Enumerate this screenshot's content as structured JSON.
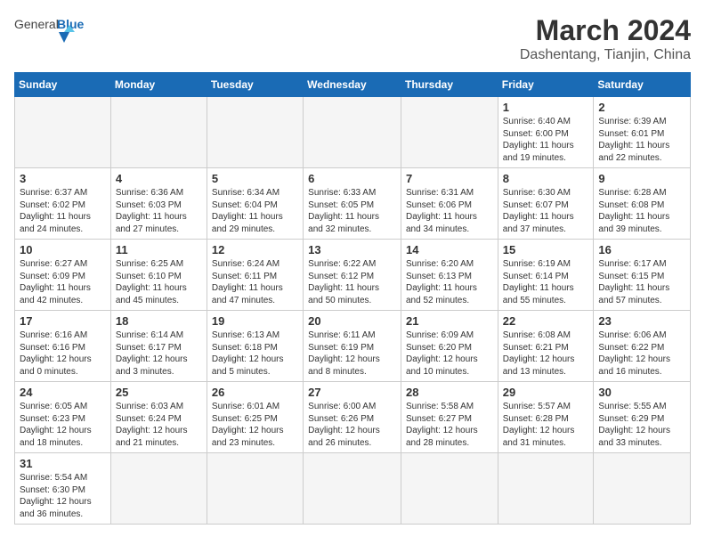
{
  "header": {
    "logo_general": "General",
    "logo_blue": "Blue",
    "month_title": "March 2024",
    "location": "Dashentang, Tianjin, China"
  },
  "weekdays": [
    "Sunday",
    "Monday",
    "Tuesday",
    "Wednesday",
    "Thursday",
    "Friday",
    "Saturday"
  ],
  "weeks": [
    [
      {
        "day": "",
        "info": ""
      },
      {
        "day": "",
        "info": ""
      },
      {
        "day": "",
        "info": ""
      },
      {
        "day": "",
        "info": ""
      },
      {
        "day": "",
        "info": ""
      },
      {
        "day": "1",
        "info": "Sunrise: 6:40 AM\nSunset: 6:00 PM\nDaylight: 11 hours and 19 minutes."
      },
      {
        "day": "2",
        "info": "Sunrise: 6:39 AM\nSunset: 6:01 PM\nDaylight: 11 hours and 22 minutes."
      }
    ],
    [
      {
        "day": "3",
        "info": "Sunrise: 6:37 AM\nSunset: 6:02 PM\nDaylight: 11 hours and 24 minutes."
      },
      {
        "day": "4",
        "info": "Sunrise: 6:36 AM\nSunset: 6:03 PM\nDaylight: 11 hours and 27 minutes."
      },
      {
        "day": "5",
        "info": "Sunrise: 6:34 AM\nSunset: 6:04 PM\nDaylight: 11 hours and 29 minutes."
      },
      {
        "day": "6",
        "info": "Sunrise: 6:33 AM\nSunset: 6:05 PM\nDaylight: 11 hours and 32 minutes."
      },
      {
        "day": "7",
        "info": "Sunrise: 6:31 AM\nSunset: 6:06 PM\nDaylight: 11 hours and 34 minutes."
      },
      {
        "day": "8",
        "info": "Sunrise: 6:30 AM\nSunset: 6:07 PM\nDaylight: 11 hours and 37 minutes."
      },
      {
        "day": "9",
        "info": "Sunrise: 6:28 AM\nSunset: 6:08 PM\nDaylight: 11 hours and 39 minutes."
      }
    ],
    [
      {
        "day": "10",
        "info": "Sunrise: 6:27 AM\nSunset: 6:09 PM\nDaylight: 11 hours and 42 minutes."
      },
      {
        "day": "11",
        "info": "Sunrise: 6:25 AM\nSunset: 6:10 PM\nDaylight: 11 hours and 45 minutes."
      },
      {
        "day": "12",
        "info": "Sunrise: 6:24 AM\nSunset: 6:11 PM\nDaylight: 11 hours and 47 minutes."
      },
      {
        "day": "13",
        "info": "Sunrise: 6:22 AM\nSunset: 6:12 PM\nDaylight: 11 hours and 50 minutes."
      },
      {
        "day": "14",
        "info": "Sunrise: 6:20 AM\nSunset: 6:13 PM\nDaylight: 11 hours and 52 minutes."
      },
      {
        "day": "15",
        "info": "Sunrise: 6:19 AM\nSunset: 6:14 PM\nDaylight: 11 hours and 55 minutes."
      },
      {
        "day": "16",
        "info": "Sunrise: 6:17 AM\nSunset: 6:15 PM\nDaylight: 11 hours and 57 minutes."
      }
    ],
    [
      {
        "day": "17",
        "info": "Sunrise: 6:16 AM\nSunset: 6:16 PM\nDaylight: 12 hours and 0 minutes."
      },
      {
        "day": "18",
        "info": "Sunrise: 6:14 AM\nSunset: 6:17 PM\nDaylight: 12 hours and 3 minutes."
      },
      {
        "day": "19",
        "info": "Sunrise: 6:13 AM\nSunset: 6:18 PM\nDaylight: 12 hours and 5 minutes."
      },
      {
        "day": "20",
        "info": "Sunrise: 6:11 AM\nSunset: 6:19 PM\nDaylight: 12 hours and 8 minutes."
      },
      {
        "day": "21",
        "info": "Sunrise: 6:09 AM\nSunset: 6:20 PM\nDaylight: 12 hours and 10 minutes."
      },
      {
        "day": "22",
        "info": "Sunrise: 6:08 AM\nSunset: 6:21 PM\nDaylight: 12 hours and 13 minutes."
      },
      {
        "day": "23",
        "info": "Sunrise: 6:06 AM\nSunset: 6:22 PM\nDaylight: 12 hours and 16 minutes."
      }
    ],
    [
      {
        "day": "24",
        "info": "Sunrise: 6:05 AM\nSunset: 6:23 PM\nDaylight: 12 hours and 18 minutes."
      },
      {
        "day": "25",
        "info": "Sunrise: 6:03 AM\nSunset: 6:24 PM\nDaylight: 12 hours and 21 minutes."
      },
      {
        "day": "26",
        "info": "Sunrise: 6:01 AM\nSunset: 6:25 PM\nDaylight: 12 hours and 23 minutes."
      },
      {
        "day": "27",
        "info": "Sunrise: 6:00 AM\nSunset: 6:26 PM\nDaylight: 12 hours and 26 minutes."
      },
      {
        "day": "28",
        "info": "Sunrise: 5:58 AM\nSunset: 6:27 PM\nDaylight: 12 hours and 28 minutes."
      },
      {
        "day": "29",
        "info": "Sunrise: 5:57 AM\nSunset: 6:28 PM\nDaylight: 12 hours and 31 minutes."
      },
      {
        "day": "30",
        "info": "Sunrise: 5:55 AM\nSunset: 6:29 PM\nDaylight: 12 hours and 33 minutes."
      }
    ],
    [
      {
        "day": "31",
        "info": "Sunrise: 5:54 AM\nSunset: 6:30 PM\nDaylight: 12 hours and 36 minutes."
      },
      {
        "day": "",
        "info": ""
      },
      {
        "day": "",
        "info": ""
      },
      {
        "day": "",
        "info": ""
      },
      {
        "day": "",
        "info": ""
      },
      {
        "day": "",
        "info": ""
      },
      {
        "day": "",
        "info": ""
      }
    ]
  ]
}
